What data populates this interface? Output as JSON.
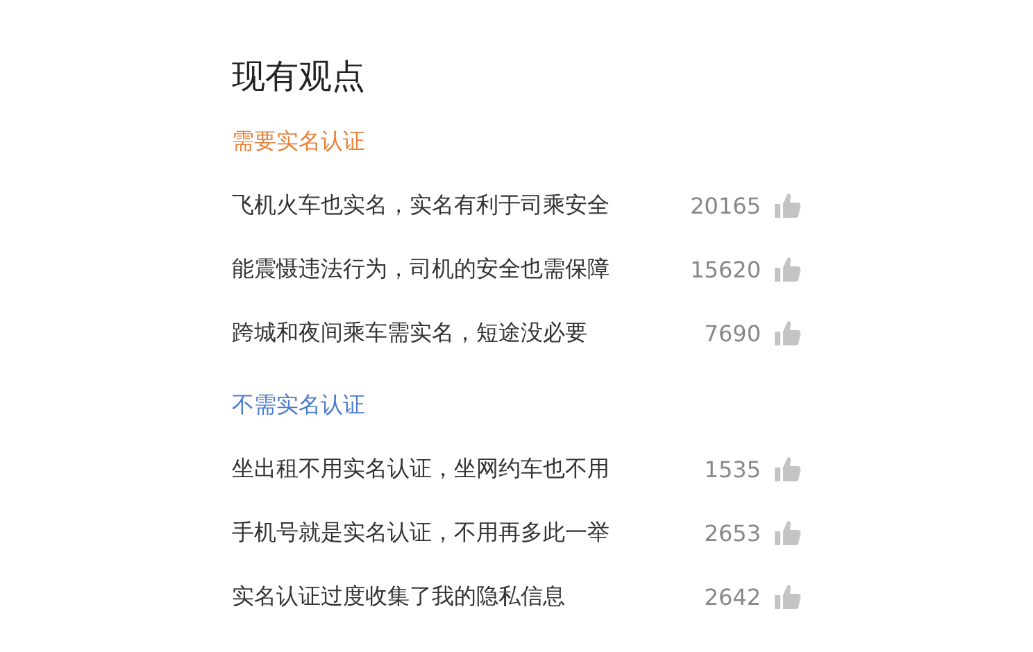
{
  "title": "现有观点",
  "sections": [
    {
      "heading": "需要实名认证",
      "color": "#e8823a",
      "opinions": [
        {
          "text": "飞机火车也实名，实名有利于司乘安全",
          "likes": "20165"
        },
        {
          "text": "能震慑违法行为，司机的安全也需保障",
          "likes": "15620"
        },
        {
          "text": "跨城和夜间乘车需实名，短途没必要",
          "likes": "7690"
        }
      ]
    },
    {
      "heading": "不需实名认证",
      "color": "#4a7bd0",
      "opinions": [
        {
          "text": "坐出租不用实名认证，坐网约车也不用",
          "likes": "1535"
        },
        {
          "text": "手机号就是实名认证，不用再多此一举",
          "likes": "2653"
        },
        {
          "text": "实名认证过度收集了我的隐私信息",
          "likes": "2642"
        }
      ]
    }
  ]
}
